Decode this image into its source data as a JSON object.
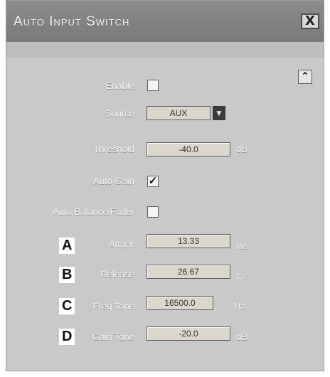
{
  "window": {
    "title": "Auto Input Switch",
    "close_glyph": "X"
  },
  "controls": {
    "enable_label": "Enable",
    "enable_checked": false,
    "source_label": "Source",
    "source_value": "AUX",
    "threshold_label": "Threshold",
    "threshold_value": "-40.0",
    "threshold_unit": "dB",
    "auto_gain_label": "Auto Gain",
    "auto_gain_checked": true,
    "auto_balance_label": "Auto Balance/Fader",
    "auto_balance_checked": false,
    "attack_label": "Attack",
    "attack_value": "13.33",
    "attack_unit": "ms",
    "release_label": "Release",
    "release_value": "26.67",
    "release_unit": "ms",
    "freq_tone_label": "Freq Tone",
    "freq_tone_value": "16500.0",
    "freq_tone_unit": "Hz",
    "gain_tone_label": "Gain Tone",
    "gain_tone_value": "-20.0",
    "gain_tone_unit": "dB"
  },
  "markers": [
    "A",
    "B",
    "C",
    "D"
  ],
  "icons": {
    "collapse": "double-chevron-up-icon",
    "dropdown": "triangle-down-icon",
    "close": "close-icon"
  }
}
